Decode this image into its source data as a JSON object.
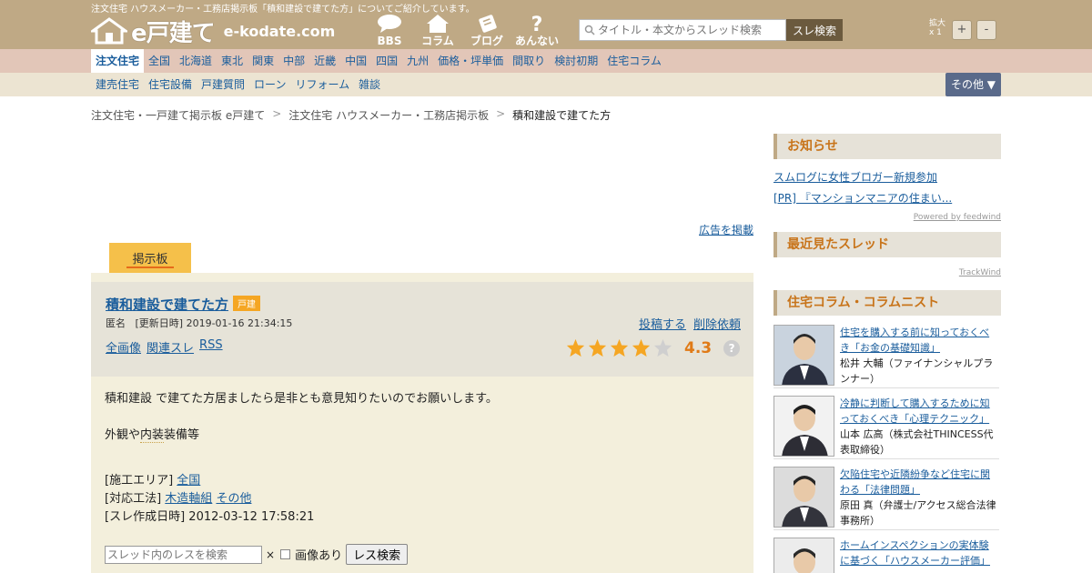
{
  "header": {
    "tagline": "注文住宅 ハウスメーカー・工務店掲示板「積和建設で建てた方」についてご紹介しています。",
    "logo_main": "e戸建て",
    "logo_domain": "e-kodate.com",
    "nav": [
      {
        "label": "BBS",
        "icon": "chat-bubble-icon"
      },
      {
        "label": "コラム",
        "icon": "house-icon"
      },
      {
        "label": "ブログ",
        "icon": "pen-icon"
      },
      {
        "label": "あんない",
        "icon": "question-icon"
      }
    ],
    "search_placeholder": "タイトル・本文からスレッド検索",
    "search_button": "スレ検索",
    "zoom_label_1": "拡大",
    "zoom_label_2": "x 1",
    "zoom_plus": "+",
    "zoom_minus": "-"
  },
  "nav_primary": [
    {
      "label": "注文住宅",
      "active": true
    },
    {
      "label": "全国"
    },
    {
      "label": "北海道"
    },
    {
      "label": "東北"
    },
    {
      "label": "関東"
    },
    {
      "label": "中部"
    },
    {
      "label": "近畿"
    },
    {
      "label": "中国"
    },
    {
      "label": "四国"
    },
    {
      "label": "九州"
    },
    {
      "label": "価格・坪単価"
    },
    {
      "label": "間取り"
    },
    {
      "label": "検討初期"
    },
    {
      "label": "住宅コラム"
    }
  ],
  "nav_secondary": [
    {
      "label": "建売住宅"
    },
    {
      "label": "住宅設備"
    },
    {
      "label": "戸建質問"
    },
    {
      "label": "ローン"
    },
    {
      "label": "リフォーム"
    },
    {
      "label": "雑談"
    }
  ],
  "more_button": "その他 ▼",
  "breadcrumb": {
    "items": [
      "注文住宅・一戸建て掲示板 e戸建て",
      "注文住宅 ハウスメーカー・工務店掲示板",
      "積和建設で建てた方"
    ],
    "separator": ">"
  },
  "ad_link": "広告を掲載",
  "board_tab": "掲示板",
  "thread": {
    "title": "積和建設で建てた方",
    "badge": "戸建",
    "author": "匿名",
    "updated": "[更新日時] 2019-01-16 21:34:15",
    "links": [
      "全画像",
      "関連スレ",
      "RSS"
    ],
    "actions": [
      "投稿する",
      "削除依頼"
    ],
    "rating": 4.3,
    "rating_text": "4.3",
    "rating_max": 5,
    "help": "?",
    "body_1": "積和建設 で建てた方居ましたら是非とも意見知りたいのでお願いします。",
    "body_2_a": "外観や",
    "body_2_b": "内装",
    "body_2_c": "装備等",
    "area_label": "[施工エリア]",
    "area_value": "全国",
    "method_label": "[対応工法]",
    "method_values": [
      "木造軸組",
      "その他"
    ],
    "created_label": "[スレ作成日時]",
    "created_value": "2012-03-12 17:58:21"
  },
  "inner_search": {
    "placeholder": "スレッド内のレスを検索",
    "x": "×",
    "image_label": "画像あり",
    "button": "レス検索"
  },
  "sidebar": {
    "news_title": "お知らせ",
    "news_items": [
      "スムログに女性ブロガー新規参加",
      "[PR] 『マンションマニアの住まい..."
    ],
    "powered": "Powered by feedwind",
    "recent_title": "最近見たスレッド",
    "trackwind": "TrackWind",
    "column_title": "住宅コラム・コラムニスト",
    "columns": [
      {
        "title": "住宅を購入する前に知っておくべき「お金の基礎知識」",
        "author": "松井 大輔（ファイナンシャルプランナー）"
      },
      {
        "title": "冷静に判断して購入するために知っておくべき「心理テクニック」",
        "author": "山本 広高（株式会社THINCESS代表取締役）"
      },
      {
        "title": "欠陥住宅や近隣紛争など住宅に関わる「法律問題」",
        "author": "原田 真（弁護士/アクセス総合法律事務所）"
      },
      {
        "title": "ホームインスペクションの実体験に基づく「ハウスメーカー評価」",
        "author": ""
      }
    ]
  },
  "colors": {
    "header_bg": "#bfa985",
    "nav1_bg": "#e2c6b8",
    "nav2_bg": "#ece4d2",
    "link": "#1a5d9c",
    "accent_orange": "#e07a16",
    "tab_yellow": "#f5c04a"
  }
}
